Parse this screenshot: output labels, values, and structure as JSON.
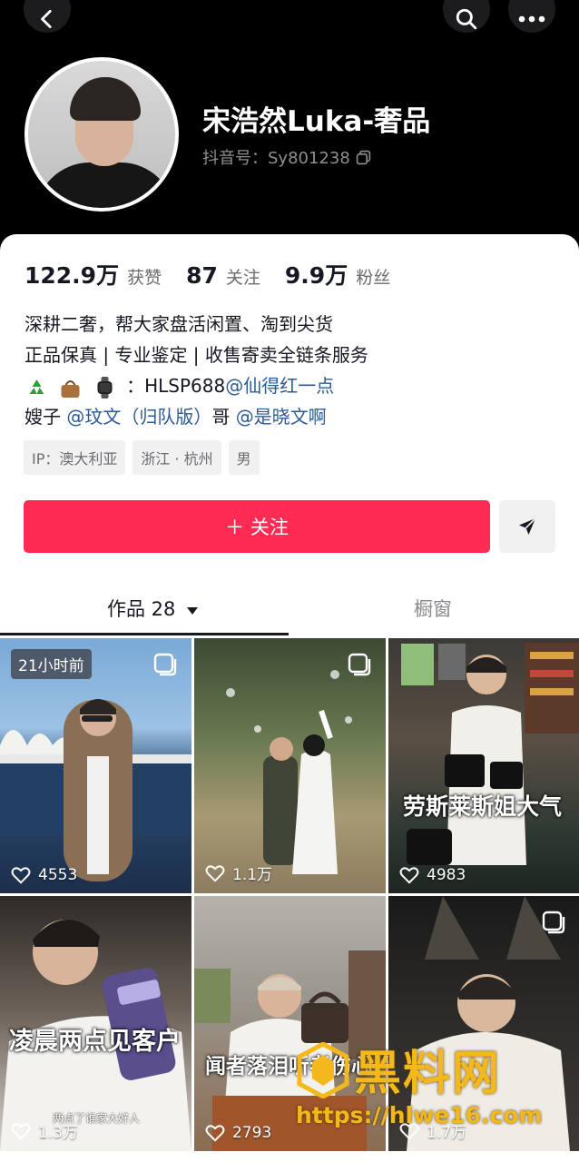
{
  "header": {
    "name": "宋浩然Luka-奢品",
    "douyin_id": "抖音号：Sy801238"
  },
  "stats": [
    {
      "num": "122.9万",
      "label": "获赞"
    },
    {
      "num": "87",
      "label": "关注"
    },
    {
      "num": "9.9万",
      "label": "粉丝"
    }
  ],
  "bio": {
    "line1": "深耕二奢，帮大家盘活闲置、淘到尖货",
    "line2": "正品保真 | 专业鉴定 | 收售寄卖全链条服务",
    "line3_text": "：HLSP688",
    "line3_mention": "@仙得红一点",
    "line4_a": "嫂子",
    "line4_mention1": "@玟文（归队版）",
    "line4_b": "哥",
    "line4_mention2": "@是晓文啊"
  },
  "tags": [
    "IP：澳大利亚",
    "浙江 · 杭州",
    "男"
  ],
  "actions": {
    "follow_label": "＋ 关注"
  },
  "tabs": {
    "works": "作品 28",
    "window": "橱窗"
  },
  "videos": [
    {
      "likes": "4553",
      "badge": "21小时前"
    },
    {
      "likes": "1.1万"
    },
    {
      "likes": "4983",
      "overlay": "劳斯莱斯姐大气"
    },
    {
      "likes": "1.3万",
      "overlay": "凌晨两点见客户",
      "sub": "两点了谁家大好人"
    },
    {
      "likes": "2793",
      "overlay": "闻者落泪听者伤心"
    },
    {
      "likes": "1.7万"
    }
  ],
  "watermark": {
    "title": "黑料网",
    "url": "https://hlwe16.com"
  },
  "colors": {
    "follow": "#fe2c55",
    "mention": "#2c5a96",
    "watermark": "#f3b81c"
  }
}
